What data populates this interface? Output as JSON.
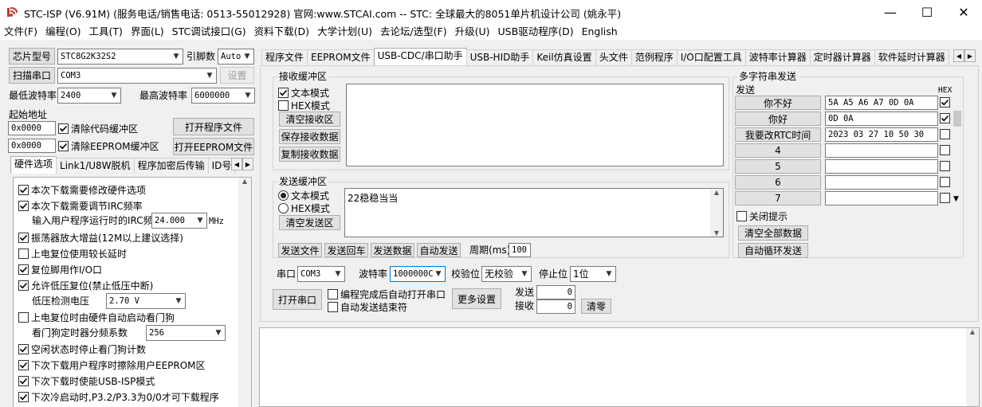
{
  "window": {
    "title": "STC-ISP (V6.91M) (服务电话/销售电话: 0513-55012928) 官网:www.STCAI.com  -- STC: 全球最大的8051单片机设计公司 (姚永平)",
    "minimize": "—",
    "maximize": "☐",
    "close": "✕"
  },
  "menu": [
    "文件(F)",
    "编程(O)",
    "工具(T)",
    "界面(L)",
    "STC调试接口(G)",
    "资料下载(D)",
    "大学计划(U)",
    "去论坛/选型(F)",
    "升级(U)",
    "USB驱动程序(D)",
    "English"
  ],
  "left": {
    "chip_model_btn": "芯片型号",
    "chip_model": "STC8G2K32S2",
    "pin_label": "引脚数",
    "pin_value": "Auto",
    "scan_port_btn": "扫描串口",
    "port_value": "COM3",
    "settings_btn": "设置",
    "min_baud_label": "最低波特率",
    "min_baud": "2400",
    "max_baud_label": "最高波特率",
    "max_baud": "6000000",
    "start_addr_label": "起始地址",
    "addr1": "0x0000",
    "clear_code": "清除代码缓冲区",
    "open_prog_btn": "打开程序文件",
    "addr2": "0x0000",
    "clear_eeprom": "清除EEPROM缓冲区",
    "open_eeprom_btn": "打开EEPROM文件",
    "tabs": [
      "硬件选项",
      "Link1/U8W脱机",
      "程序加密后传输",
      "ID号"
    ],
    "options": [
      {
        "label": "本次下载需要修改硬件选项",
        "checked": true
      },
      {
        "label": "本次下载需要调节IRC频率",
        "checked": true
      }
    ],
    "irc_label": "输入用户程序运行时的IRC频率",
    "irc_value": "24.000",
    "irc_unit": "MHz",
    "options2": [
      {
        "label": "振荡器放大增益(12M以上建议选择)",
        "checked": true
      },
      {
        "label": "上电复位使用较长延时",
        "checked": false
      },
      {
        "label": "复位脚用作I/O口",
        "checked": true
      },
      {
        "label": "允许低压复位(禁止低压中断)",
        "checked": true
      }
    ],
    "lvd_label": "低压检测电压",
    "lvd_value": "2.70 V",
    "wdt_opt": {
      "label": "上电复位时由硬件自动启动看门狗",
      "checked": false
    },
    "wdt_label": "看门狗定时器分频系数",
    "wdt_value": "256",
    "options3": [
      {
        "label": "空闲状态时停止看门狗计数",
        "checked": true
      },
      {
        "label": "下次下载用户程序时擦除用户EEPROM区",
        "checked": true
      },
      {
        "label": "下次下载时使能USB-ISP模式",
        "checked": true
      },
      {
        "label": "下次冷启动时,P3.2/P3.3为0/0才可下载程序",
        "checked": true
      }
    ]
  },
  "right": {
    "tabs": [
      "程序文件",
      "EEPROM文件",
      "USB-CDC/串口助手",
      "USB-HID助手",
      "Keil仿真设置",
      "头文件",
      "范例程序",
      "I/O口配置工具",
      "波特率计算器",
      "定时器计算器",
      "软件延时计算器"
    ],
    "active_tab": 2,
    "recv": {
      "title": "接收缓冲区",
      "text_mode": "文本模式",
      "hex_mode": "HEX模式",
      "clear_btn": "清空接收区",
      "save_btn": "保存接收数据",
      "copy_btn": "复制接收数据"
    },
    "send": {
      "title": "发送缓冲区",
      "text_mode": "文本模式",
      "hex_mode": "HEX模式",
      "clear_btn": "清空发送区",
      "content": "22稳稳当当",
      "send_file_btn": "发送文件",
      "send_return_btn": "发送回车",
      "send_data_btn": "发送数据",
      "auto_send_btn": "自动发送",
      "period_label": "周期(ms)",
      "period_value": "100"
    },
    "multi": {
      "title": "多字符串发送",
      "send_header": "发送",
      "hex_header": "HEX",
      "rows": [
        {
          "btn": "你不好",
          "value": "5A A5 A6 A7 0D 0A",
          "hex": true
        },
        {
          "btn": "你好",
          "value": "0D 0A",
          "hex": true
        },
        {
          "btn": "我要改RTC时间",
          "value": "2023 03 27 10 50 30",
          "hex": false
        },
        {
          "btn": "4",
          "value": "",
          "hex": false
        },
        {
          "btn": "5",
          "value": "",
          "hex": false
        },
        {
          "btn": "6",
          "value": "",
          "hex": false
        },
        {
          "btn": "7",
          "value": "",
          "hex": false
        }
      ],
      "close_hint": "关闭提示",
      "clear_all_btn": "清空全部数据",
      "auto_loop_btn": "自动循环发送"
    },
    "serial": {
      "port_label": "串口",
      "port_value": "COM3",
      "baud_label": "波特率",
      "baud_value": "1000000C",
      "parity_label": "校验位",
      "parity_value": "无校验",
      "stop_label": "停止位",
      "stop_value": "1位",
      "open_btn": "打开串口",
      "auto_open": "编程完成后自动打开串口",
      "auto_end": "自动发送结束符",
      "more_btn": "更多设置",
      "send_label": "发送",
      "send_count": "0",
      "recv_label": "接收",
      "recv_count": "0",
      "clear_btn": "清零"
    }
  }
}
